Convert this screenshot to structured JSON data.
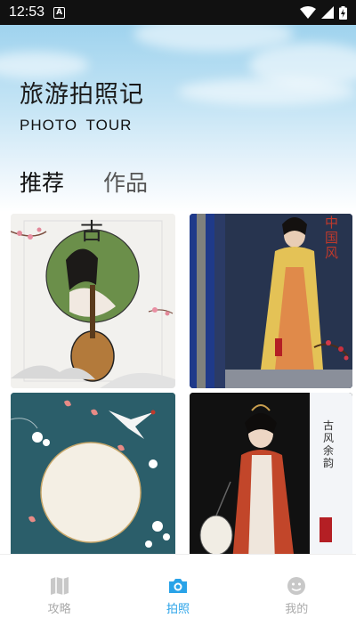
{
  "status_bar": {
    "time": "12:53",
    "notification_icon": "a-icon",
    "wifi_icon": "wifi-icon",
    "signal_icon": "signal-icon",
    "battery_icon": "battery-charging-icon"
  },
  "header": {
    "title": "旅游拍照记",
    "subtitle": "PHOTO  TOUR"
  },
  "tabs": [
    {
      "label": "推荐",
      "active": true
    },
    {
      "label": "作品",
      "active": false
    }
  ],
  "gallery": {
    "cards": [
      {
        "name": "guzheng-portrait-template",
        "text": "古"
      },
      {
        "name": "chinese-style-dress-photo",
        "text": "中国风"
      },
      {
        "name": "cranes-circle-frame-template",
        "text": ""
      },
      {
        "name": "hanfu-lantern-photo",
        "text": "古风余韵"
      }
    ]
  },
  "bottom_nav": [
    {
      "label": "攻略",
      "icon": "map-icon",
      "active": false
    },
    {
      "label": "拍照",
      "icon": "camera-icon",
      "active": true
    },
    {
      "label": "我的",
      "icon": "profile-icon",
      "active": false
    }
  ],
  "colors": {
    "accent": "#2aa3e8",
    "inactive": "#aaaaaa"
  }
}
